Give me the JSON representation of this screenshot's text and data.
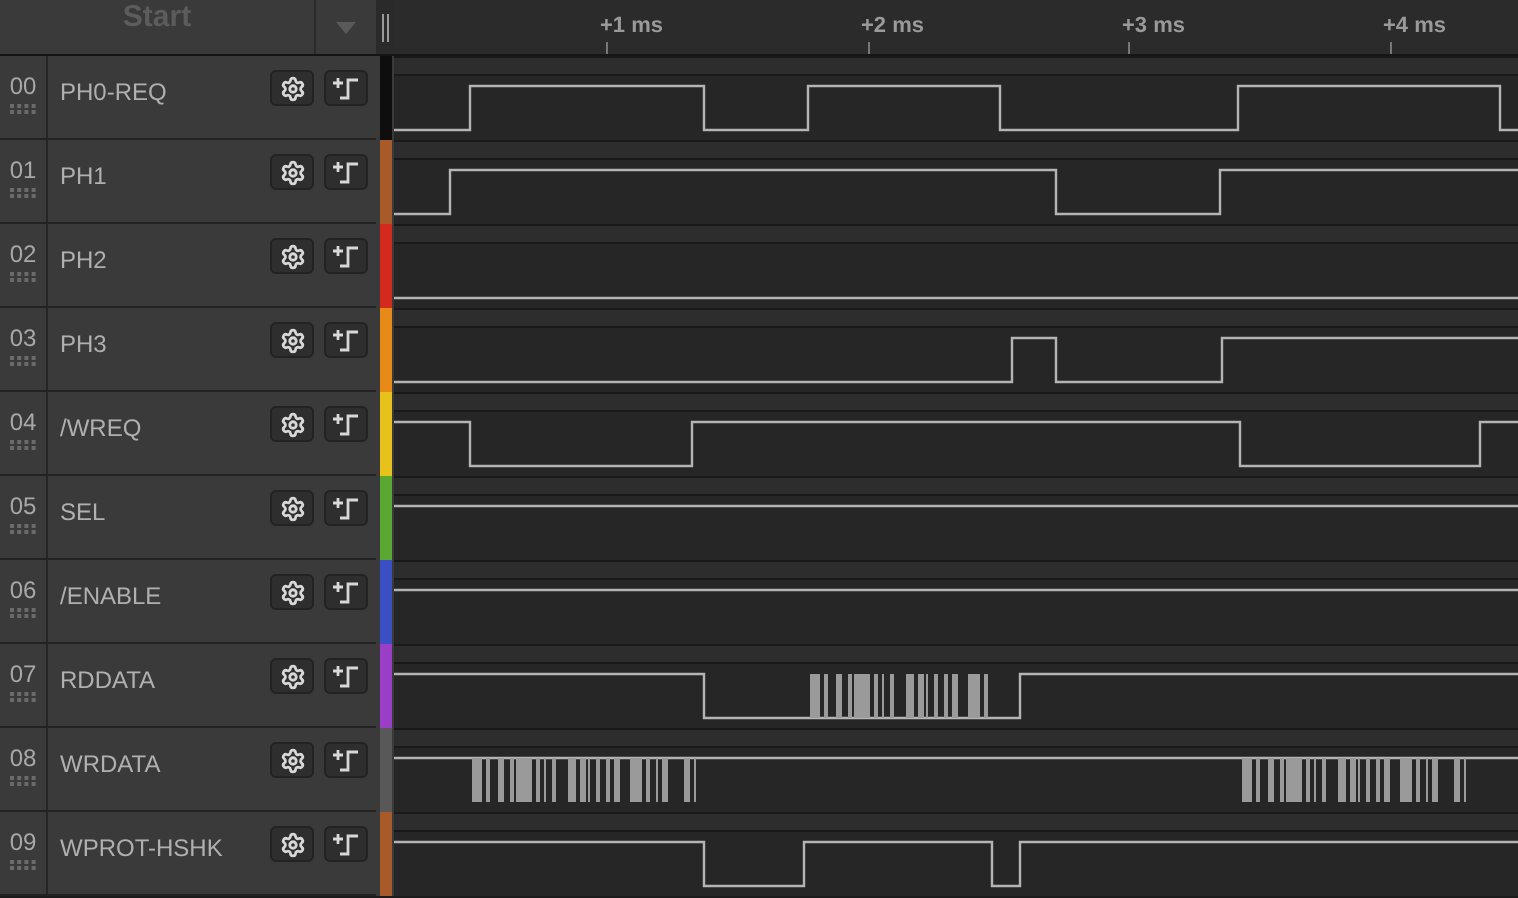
{
  "header": {
    "start_button": "Start"
  },
  "timeline": {
    "ticks": [
      "+1 ms",
      "+2 ms",
      "+3 ms",
      "+4 ms"
    ]
  },
  "channels": [
    {
      "number": "00",
      "name": "PH0-REQ",
      "color": "#0e0e0e"
    },
    {
      "number": "01",
      "name": "PH1",
      "color": "#a85a28"
    },
    {
      "number": "02",
      "name": "PH2",
      "color": "#d42a1e"
    },
    {
      "number": "03",
      "name": "PH3",
      "color": "#e88a1a"
    },
    {
      "number": "04",
      "name": "/WREQ",
      "color": "#e6c21a"
    },
    {
      "number": "05",
      "name": "SEL",
      "color": "#5aa832"
    },
    {
      "number": "06",
      "name": "/ENABLE",
      "color": "#3a4fc4"
    },
    {
      "number": "07",
      "name": "RDDATA",
      "color": "#9a3ec8"
    },
    {
      "number": "08",
      "name": "WRDATA",
      "color": "#585858"
    },
    {
      "number": "09",
      "name": "WPROT-HSHK",
      "color": "#a85a28"
    }
  ]
}
